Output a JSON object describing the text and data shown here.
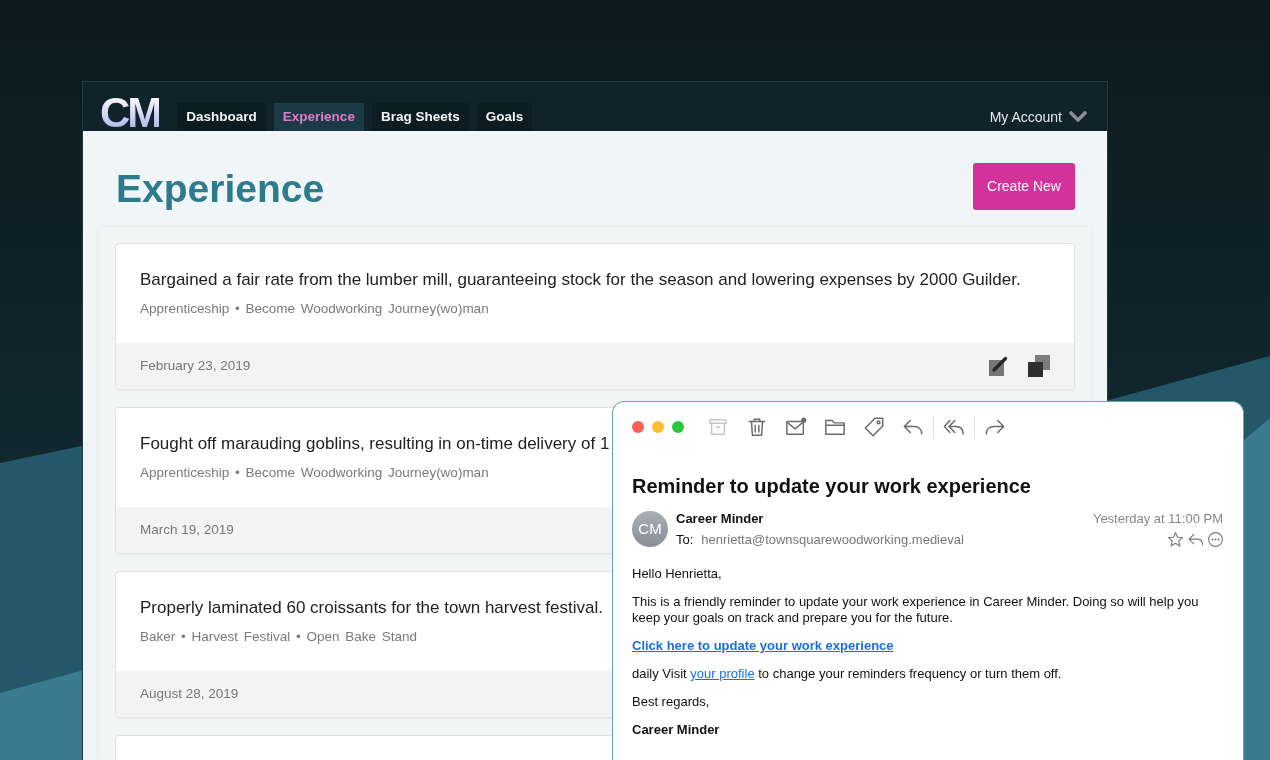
{
  "app": {
    "logo": "CM",
    "nav": [
      {
        "label": "Dashboard",
        "selected": false
      },
      {
        "label": "Experience",
        "selected": true
      },
      {
        "label": "Brag Sheets",
        "selected": false
      },
      {
        "label": "Goals",
        "selected": false
      }
    ],
    "account": "My Account"
  },
  "page": {
    "title": "Experience",
    "create_button": "Create New"
  },
  "entries": [
    {
      "title": "Bargained a fair rate from the lumber mill, guaranteeing stock for the season and lowering expenses by 2000 Guilder.",
      "meta": "Apprenticeship • Become Woodworking Journey(wo)man",
      "date": "February 23, 2019"
    },
    {
      "title": "Fought off marauding goblins, resulting in on-time delivery of 1",
      "meta": "Apprenticeship • Become Woodworking Journey(wo)man",
      "date": "March 19, 2019"
    },
    {
      "title": "Properly laminated 60 croissants for the town harvest festival.",
      "meta": "Baker • Harvest Festival • Open Bake Stand",
      "date": "August 28, 2019"
    }
  ],
  "email": {
    "toolbar": [
      {
        "kind": "archive",
        "disabled": true
      },
      {
        "kind": "trash",
        "disabled": false
      },
      {
        "kind": "mail",
        "disabled": false
      },
      {
        "kind": "folder",
        "disabled": false
      },
      {
        "kind": "tag",
        "disabled": false
      },
      {
        "kind": "reply",
        "disabled": false
      },
      {
        "kind": "reply_all",
        "disabled": false
      },
      {
        "kind": "forward",
        "disabled": false
      }
    ],
    "subject": "Reminder to update your work experience",
    "avatar_initials": "CM",
    "sender": "Career Minder",
    "to_label": "To:",
    "recipient": "henrietta@townsquarewoodworking.medieval",
    "time": "Yesterday at 11:00 PM",
    "greeting": "Hello Henrietta,",
    "paragraph": "This is a friendly reminder to update your work experience in Career Minder. Doing so will help you keep your goals on track and prepare you for the future.",
    "cta_link": "Click here to update your work experience",
    "settings_line": {
      "before": "daily Visit",
      "link": "your profile",
      "after": "to change your reminders frequency or turn them off."
    },
    "closing": "Best regards,",
    "signature": "Career Minder"
  }
}
